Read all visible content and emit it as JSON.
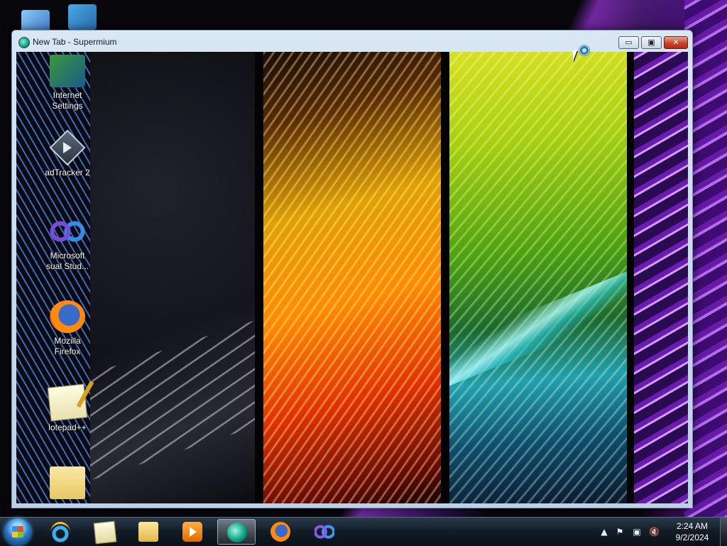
{
  "window": {
    "title": "New Tab - Supermium",
    "min_label": "▭",
    "max_label": "▣",
    "close_label": "✕"
  },
  "desktop_icons": [
    {
      "label_line1": "Internet",
      "label_line2": "Settings",
      "icon": "internet-settings-icon"
    },
    {
      "label_line1": "adTracker 2",
      "label_line2": "",
      "icon": "adtracker-icon"
    },
    {
      "label_line1": "Microsoft",
      "label_line2": "sual Stud...",
      "icon": "visual-studio-icon"
    },
    {
      "label_line1": "Mozilla",
      "label_line2": "Firefox",
      "icon": "firefox-icon"
    },
    {
      "label_line1": "lotepad++",
      "label_line2": "",
      "icon": "notepad-plus-plus-icon"
    },
    {
      "label_line1": "",
      "label_line2": "",
      "icon": "folder-icon"
    }
  ],
  "taskbar": {
    "pinned": [
      {
        "name": "internet-explorer",
        "icon": "internet-explorer-icon"
      },
      {
        "name": "notepad",
        "icon": "notepad-icon"
      },
      {
        "name": "file-explorer",
        "icon": "folder-icon"
      },
      {
        "name": "media-player",
        "icon": "media-player-icon"
      },
      {
        "name": "supermium",
        "icon": "supermium-icon",
        "active": true
      },
      {
        "name": "firefox",
        "icon": "firefox-icon"
      },
      {
        "name": "visual-studio",
        "icon": "visual-studio-icon"
      }
    ],
    "tray": {
      "arrow": "▲",
      "flag": "⚑",
      "net": "▣",
      "vol": "🔇"
    },
    "clock": {
      "time": "2:24 AM",
      "date": "9/2/2024"
    }
  },
  "colors": {
    "accent": "#2a78c8",
    "titlebar": "#bcd0e6",
    "close": "#c9452e"
  }
}
